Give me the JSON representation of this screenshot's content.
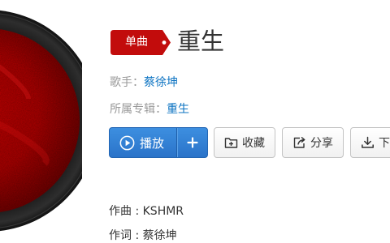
{
  "song": {
    "type_tag": "单曲",
    "title": "重生"
  },
  "meta": {
    "singer_label": "歌手：",
    "singer": "蔡徐坤",
    "album_label": "所属专辑：",
    "album": "重生"
  },
  "actions": {
    "play_label": "播放",
    "collect_label": "收藏",
    "share_label": "分享",
    "download_label": "下"
  },
  "credits": {
    "composer_label": "作曲 : ",
    "composer": "KSHMR",
    "lyricist_label": "作词 : ",
    "lyricist": "蔡徐坤"
  },
  "colors": {
    "tag_red": "#c20c0c",
    "link_blue": "#0c73c2",
    "play_blue": "#2f7fd3"
  },
  "icons": {
    "play": "play-circle-icon",
    "add": "plus-icon",
    "collect": "folder-plus-icon",
    "share": "share-icon",
    "download": "download-icon"
  }
}
